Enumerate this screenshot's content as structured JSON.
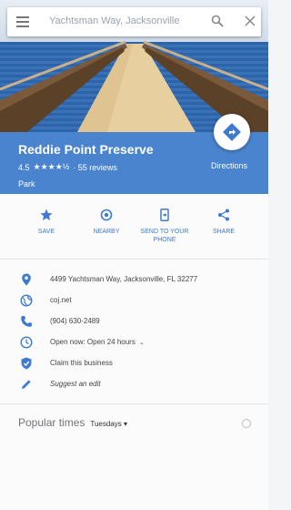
{
  "search": {
    "query": "Yachtsman Way, Jacksonville"
  },
  "place": {
    "name": "Reddie Point Preserve",
    "rating": "4.5",
    "stars": "★★★★½",
    "reviews": "· 55 reviews",
    "category": "Park",
    "directions_label": "Directions"
  },
  "actions": [
    {
      "label": "SAVE",
      "icon": "star-icon"
    },
    {
      "label": "NEARBY",
      "icon": "nearby-icon"
    },
    {
      "label": "SEND TO YOUR PHONE",
      "icon": "phone-icon"
    },
    {
      "label": "SHARE",
      "icon": "share-icon"
    }
  ],
  "details": {
    "address": "4499 Yachtsman Way, Jacksonville, FL 32277",
    "website": "coj.net",
    "phone": "(904) 630-2489",
    "hours": "Open now:  Open 24 hours",
    "claim": "Claim this business",
    "suggest": "Suggest an edit"
  },
  "popular": {
    "title": "Popular times",
    "day": "Tuesdays ▾"
  },
  "colors": {
    "header_blue": "#4a84cf",
    "accent_blue": "#3d7ad0"
  }
}
